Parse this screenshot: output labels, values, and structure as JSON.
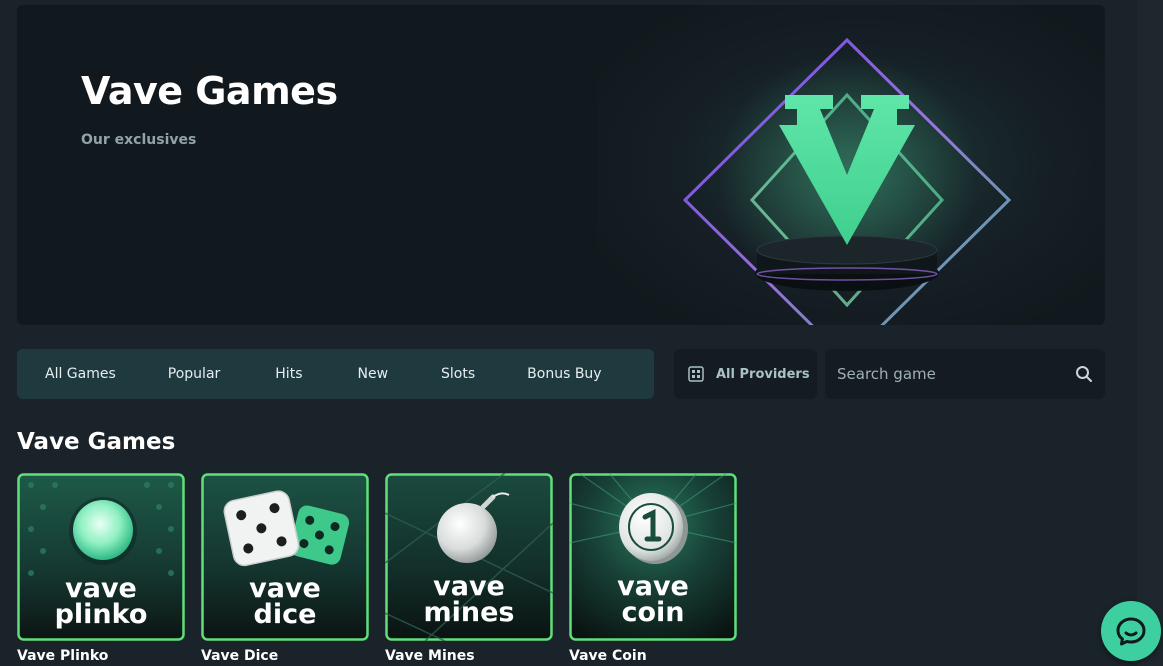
{
  "hero": {
    "title": "Vave Games",
    "subtitle": "Our exclusives"
  },
  "tabs": [
    {
      "label": "All Games"
    },
    {
      "label": "Popular"
    },
    {
      "label": "Hits"
    },
    {
      "label": "New"
    },
    {
      "label": "Slots"
    },
    {
      "label": "Bonus Buy"
    }
  ],
  "providers": {
    "label": "All Providers",
    "icon": "grid-icon"
  },
  "search": {
    "placeholder": "Search game",
    "value": "",
    "icon": "search-icon"
  },
  "section": {
    "title": "Vave Games"
  },
  "games": [
    {
      "name": "Vave Plinko",
      "line1": "vave",
      "line2": "plinko",
      "icon": "plinko-ball-icon"
    },
    {
      "name": "Vave Dice",
      "line1": "vave",
      "line2": "dice",
      "icon": "dice-icon"
    },
    {
      "name": "Vave Mines",
      "line1": "vave",
      "line2": "mines",
      "icon": "bomb-icon"
    },
    {
      "name": "Vave Coin",
      "line1": "vave",
      "line2": "coin",
      "icon": "coin-icon"
    }
  ],
  "chat": {
    "icon": "chat-bubble-icon"
  },
  "colors": {
    "accent": "#4fd59b",
    "card_border": "#5fe07a",
    "tabs_bg": "#1e3a3f",
    "page_bg": "#1a2329"
  }
}
